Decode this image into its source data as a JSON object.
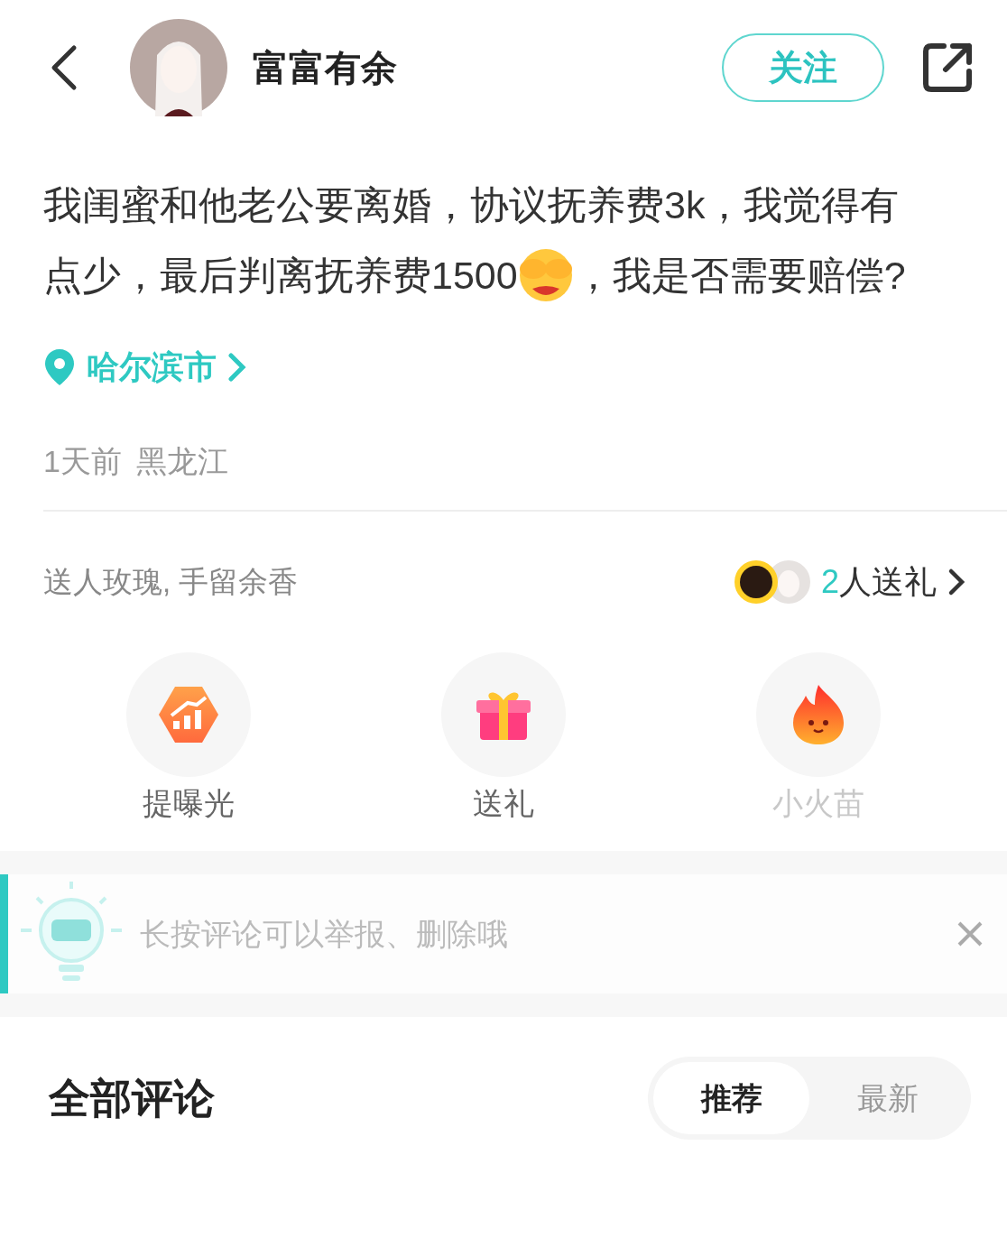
{
  "header": {
    "username": "富富有余",
    "follow_button": "关注"
  },
  "post": {
    "text_parts": [
      "我闺蜜和他老公要离婚，协议抚养费3k，我觉得有",
      "点少，最后判离抚养费1500",
      "，我是否需要赔偿?"
    ],
    "location": "哈尔滨市",
    "time": "1天前",
    "region": "黑龙江"
  },
  "gifts": {
    "slogan": "送人玫瑰, 手留余香",
    "count": "2",
    "count_label": "人送礼"
  },
  "actions": [
    {
      "kind": "boost",
      "label": "提曝光",
      "disabled": false
    },
    {
      "kind": "gift",
      "label": "送礼",
      "disabled": false
    },
    {
      "kind": "flame",
      "label": "小火苗",
      "disabled": true
    }
  ],
  "tip": {
    "text": "长按评论可以举报、删除哦"
  },
  "comments": {
    "title": "全部评论",
    "sort_tabs": [
      {
        "label": "推荐",
        "selected": true
      },
      {
        "label": "最新",
        "selected": false
      }
    ]
  }
}
